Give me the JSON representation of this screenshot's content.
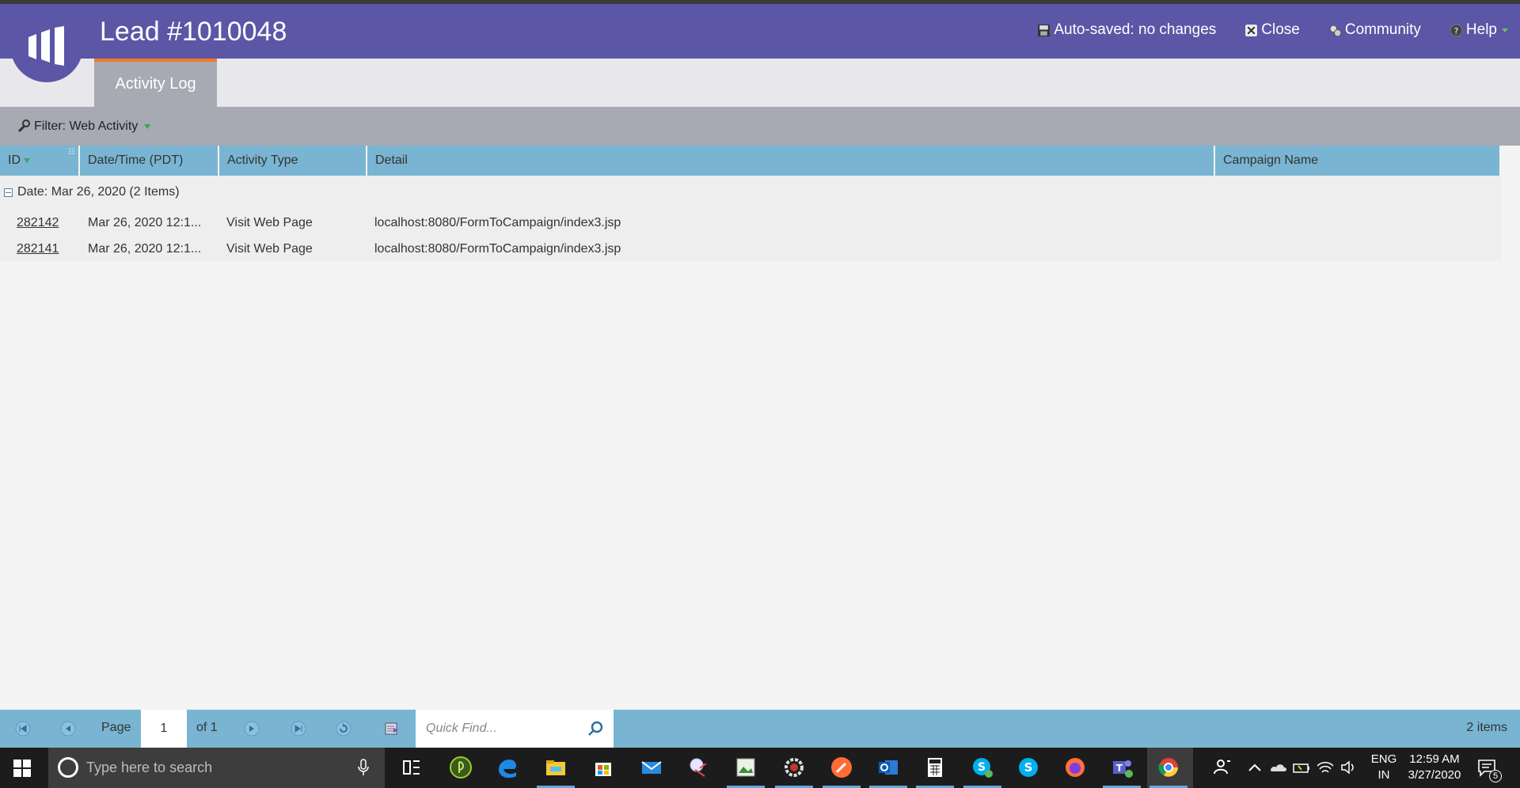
{
  "header": {
    "title": "Lead #1010048",
    "autosave": "Auto-saved: no changes",
    "close": "Close",
    "community": "Community",
    "help": "Help"
  },
  "tabs": [
    {
      "label": "Activity Log",
      "active": true
    }
  ],
  "filter": {
    "label": "Filter: Web Activity"
  },
  "grid": {
    "columns": [
      "ID",
      "Date/Time (PDT)",
      "Activity Type",
      "Detail",
      "Campaign Name"
    ],
    "group_label": "Date: Mar 26, 2020 (2 Items)",
    "rows": [
      {
        "id": "282142",
        "datetime": "Mar 26, 2020 12:1...",
        "activity_type": "Visit Web Page",
        "detail": "localhost:8080/FormToCampaign/index3.jsp",
        "campaign": ""
      },
      {
        "id": "282141",
        "datetime": "Mar 26, 2020 12:1...",
        "activity_type": "Visit Web Page",
        "detail": "localhost:8080/FormToCampaign/index3.jsp",
        "campaign": ""
      }
    ]
  },
  "pager": {
    "page_label": "Page",
    "page_value": "1",
    "of_label": "of 1",
    "quickfind_placeholder": "Quick Find...",
    "items_count": "2 items"
  },
  "taskbar": {
    "search_placeholder": "Type here to search",
    "lang_line1": "ENG",
    "lang_line2": "IN",
    "time": "12:59 AM",
    "date": "3/27/2020",
    "notification_count": "5"
  },
  "colors": {
    "header_bg": "#5c56a6",
    "accent_orange": "#f07b25",
    "grid_header_bg": "#79b5d2",
    "filter_bg": "#a7a9b3"
  }
}
